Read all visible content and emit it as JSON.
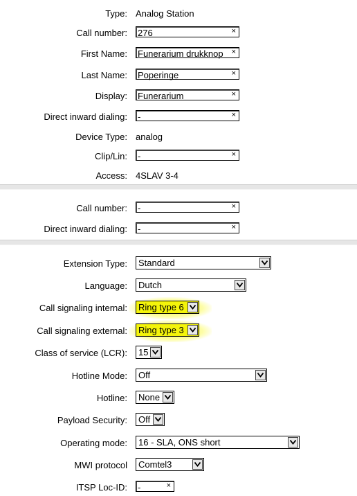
{
  "device": {
    "type_label": "Type:",
    "type_value": "Analog Station",
    "call_number_label": "Call number:",
    "call_number_value": "276",
    "first_name_label": "First Name:",
    "first_name_value": "Funerarium drukknop",
    "last_name_label": "Last Name:",
    "last_name_value": "Poperinge",
    "display_label": "Display:",
    "display_value": "Funerarium",
    "did_label": "Direct inward dialing:",
    "did_value": "-",
    "device_type_label": "Device Type:",
    "device_type_value": "analog",
    "clip_lin_label": "Clip/Lin:",
    "clip_lin_value": "-",
    "access_label": "Access:",
    "access_value": "4SLAV 3-4"
  },
  "secondary": {
    "call_number_label": "Call number:",
    "call_number_value": "-",
    "did_label": "Direct inward dialing:",
    "did_value": "-"
  },
  "settings": {
    "extension_type_label": "Extension Type:",
    "extension_type_value": "Standard",
    "language_label": "Language:",
    "language_value": "Dutch",
    "signal_internal_label": "Call signaling internal:",
    "signal_internal_value": "Ring type 6",
    "signal_external_label": "Call signaling external:",
    "signal_external_value": "Ring type 3",
    "cos_label": "Class of service (LCR):",
    "cos_value": "15",
    "hotline_mode_label": "Hotline Mode:",
    "hotline_mode_value": "Off",
    "hotline_label": "Hotline:",
    "hotline_value": "None",
    "payload_label": "Payload Security:",
    "payload_value": "Off",
    "operating_mode_label": "Operating mode:",
    "operating_mode_value": "16 - SLA, ONS short",
    "mwi_label": "MWI protocol",
    "mwi_value": "Comtel3",
    "itsp_label": "ITSP Loc-ID:",
    "itsp_value": "-"
  },
  "icons": {
    "clear": "×",
    "dropdown": "chevron-down-icon"
  },
  "colors": {
    "highlight": "#f4f40a"
  }
}
